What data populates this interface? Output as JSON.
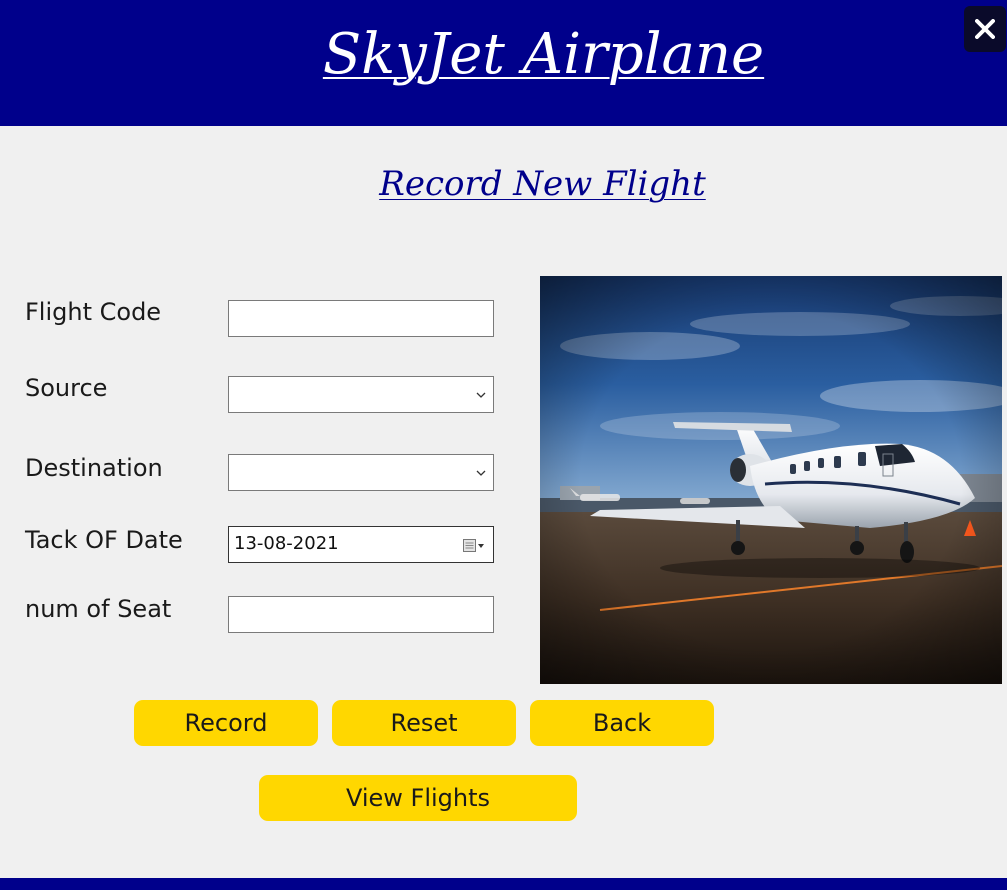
{
  "header": {
    "title": "SkyJet Airplane",
    "background": "#00008b",
    "close_icon": "close-icon"
  },
  "form": {
    "title": "Record New Flight",
    "fields": {
      "flight_code": {
        "label": "Flight Code",
        "value": ""
      },
      "source": {
        "label": "Source",
        "value": ""
      },
      "destination": {
        "label": "Destination",
        "value": ""
      },
      "take_off_date": {
        "label": "Tack OF Date",
        "value": "13-08-2021"
      },
      "num_of_seat": {
        "label": "num of Seat",
        "value": ""
      }
    }
  },
  "buttons": {
    "record": "Record",
    "reset": "Reset",
    "back": "Back",
    "view_flights": "View Flights",
    "color": "#ffd700"
  }
}
